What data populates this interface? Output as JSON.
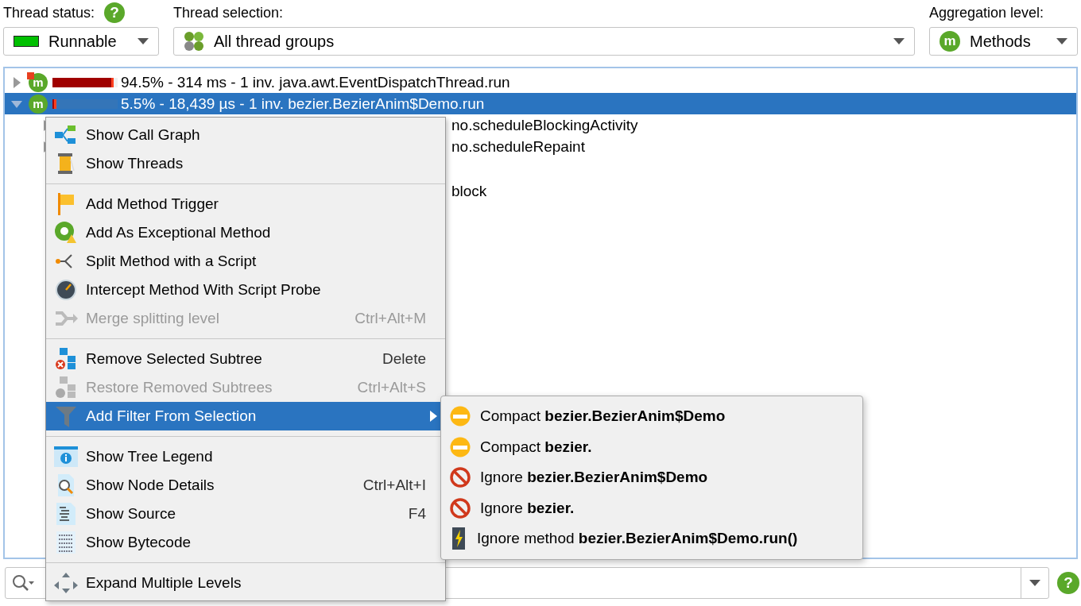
{
  "toolbar": {
    "thread_status": {
      "label": "Thread status:",
      "help_icon": "?",
      "value": "Runnable"
    },
    "thread_selection": {
      "label": "Thread selection:",
      "value": "All thread groups"
    },
    "aggregation": {
      "label": "Aggregation level:",
      "icon_letter": "m",
      "value": "Methods"
    }
  },
  "search": {
    "help_icon": "?"
  },
  "tree": {
    "rows": [
      {
        "text": "94.5% - 314 ms - 1 inv. java.awt.EventDispatchThread.run",
        "icon_letter": "m",
        "level": 0.945,
        "expanded": false,
        "selected": false,
        "hot": true
      },
      {
        "text": "5.5% - 18,439 µs - 1 inv. bezier.BezierAnim$Demo.run",
        "icon_letter": "m",
        "level": 0.055,
        "expanded": true,
        "selected": true,
        "hot": false,
        "children": [
          {
            "text": "no.scheduleBlockingActivity",
            "expanded": false
          },
          {
            "text": "no.scheduleRepaint",
            "expanded": false
          },
          {
            "text": "block"
          }
        ]
      }
    ]
  },
  "context_menu": {
    "items": [
      {
        "kind": "item",
        "label": "Show Call Graph",
        "disabled": false,
        "selected": false
      },
      {
        "kind": "item",
        "label": "Show Threads",
        "disabled": false,
        "selected": false
      },
      {
        "kind": "separator"
      },
      {
        "kind": "item",
        "label": "Add Method Trigger",
        "disabled": false,
        "selected": false
      },
      {
        "kind": "item",
        "label": "Add As Exceptional Method",
        "disabled": false,
        "selected": false
      },
      {
        "kind": "item",
        "label": "Split Method with a Script",
        "disabled": false,
        "selected": false
      },
      {
        "kind": "item",
        "label": "Intercept Method With Script Probe",
        "disabled": false,
        "selected": false
      },
      {
        "kind": "item",
        "label": "Merge splitting level",
        "shortcut": "Ctrl+Alt+M",
        "disabled": true,
        "selected": false
      },
      {
        "kind": "separator"
      },
      {
        "kind": "item",
        "label": "Remove Selected Subtree",
        "shortcut": "Delete",
        "disabled": false,
        "selected": false
      },
      {
        "kind": "item",
        "label": "Restore Removed Subtrees",
        "shortcut": "Ctrl+Alt+S",
        "disabled": true,
        "selected": false
      },
      {
        "kind": "submenu",
        "label": "Add Filter From Selection",
        "disabled": false,
        "selected": true
      },
      {
        "kind": "separator"
      },
      {
        "kind": "item",
        "label": "Show Tree Legend",
        "disabled": false,
        "selected": false
      },
      {
        "kind": "item",
        "label": "Show Node Details",
        "shortcut": "Ctrl+Alt+I",
        "disabled": false,
        "selected": false
      },
      {
        "kind": "item",
        "label": "Show Source",
        "shortcut": "F4",
        "disabled": false,
        "selected": false
      },
      {
        "kind": "item",
        "label": "Show Bytecode",
        "disabled": false,
        "selected": false
      },
      {
        "kind": "separator"
      },
      {
        "kind": "item",
        "label": "Expand Multiple Levels",
        "disabled": false,
        "selected": false
      }
    ]
  },
  "submenu": {
    "items": [
      {
        "kind": "compact",
        "label": "Compact **bezier.BezierAnim$Demo**"
      },
      {
        "kind": "compact",
        "label": "Compact **bezier.**"
      },
      {
        "kind": "ignore",
        "label": "Ignore **bezier.BezierAnim$Demo**"
      },
      {
        "kind": "ignore",
        "label": "Ignore **bezier.**"
      },
      {
        "kind": "ignore_method",
        "label": "Ignore method **bezier.BezierAnim$Demo.run()**"
      }
    ]
  }
}
